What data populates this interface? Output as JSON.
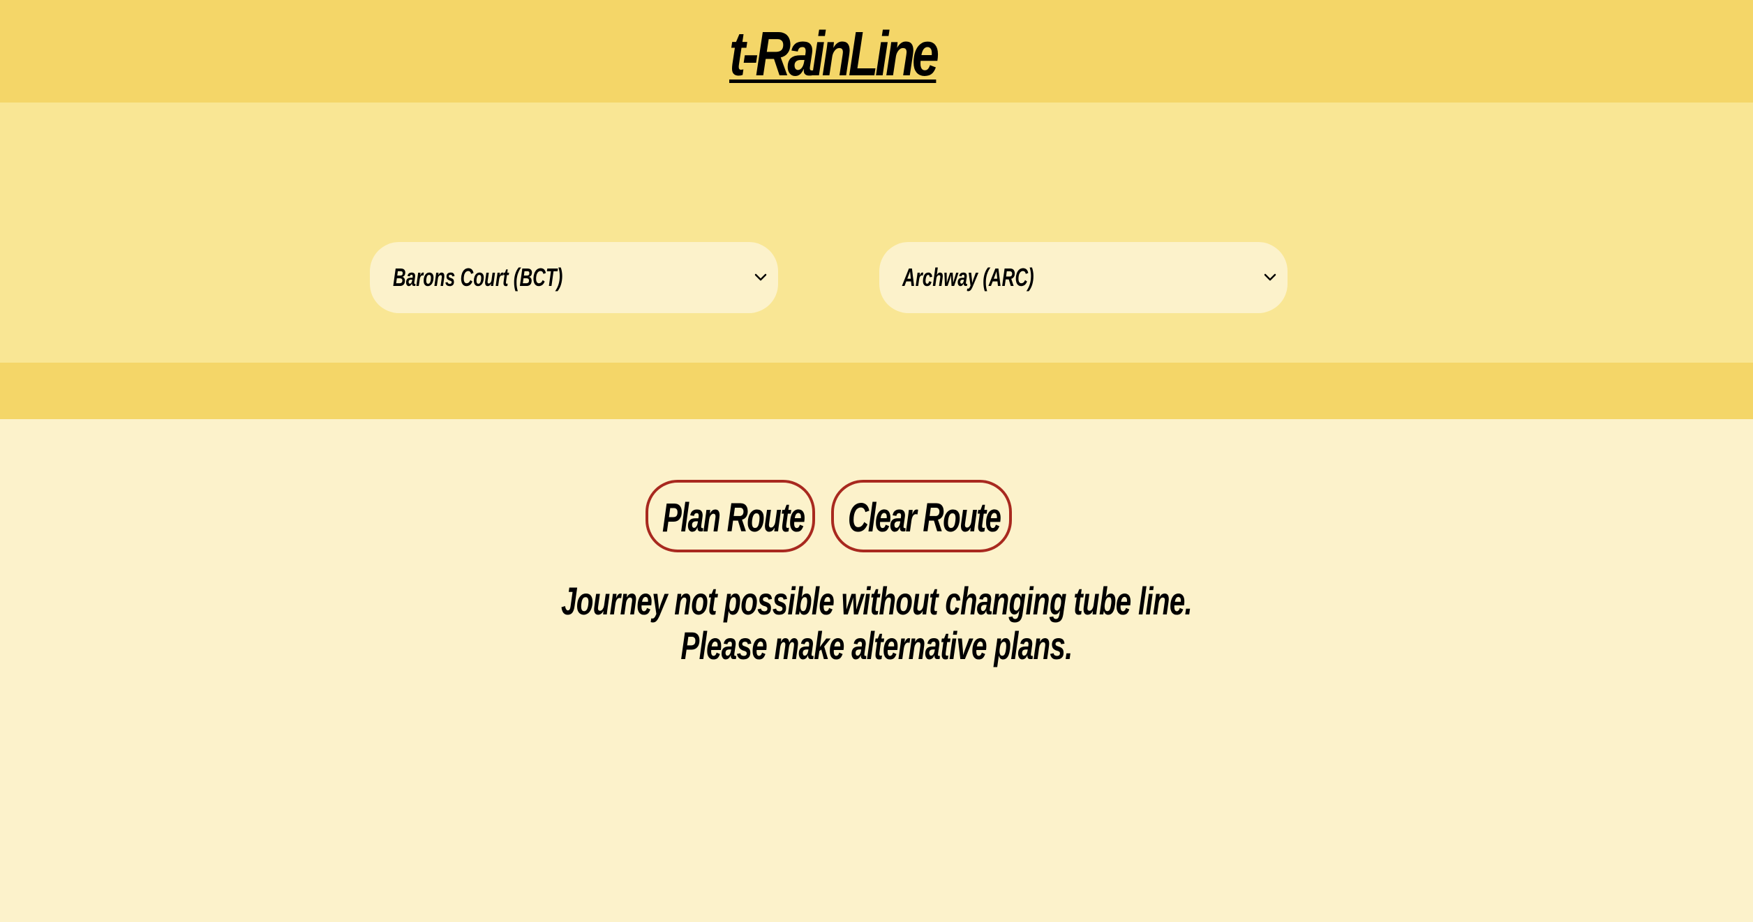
{
  "app": {
    "title": "t-RainLine"
  },
  "route_selector": {
    "from_station": "Barons Court (BCT)",
    "to_station": "Archway (ARC)"
  },
  "actions": {
    "plan_label": "Plan Route",
    "clear_label": "Clear Route"
  },
  "result": {
    "message_line1": "Journey not possible without changing tube line.",
    "message_line2": "Please make alternative plans."
  },
  "icons": {
    "from_dropdown": "chevron-down-icon",
    "to_dropdown": "chevron-down-icon"
  },
  "colors": {
    "header_bg": "#F4D668",
    "selector_band_bg": "#F9E694",
    "page_bg": "#FCF2CB",
    "button_border": "#A8291F"
  }
}
